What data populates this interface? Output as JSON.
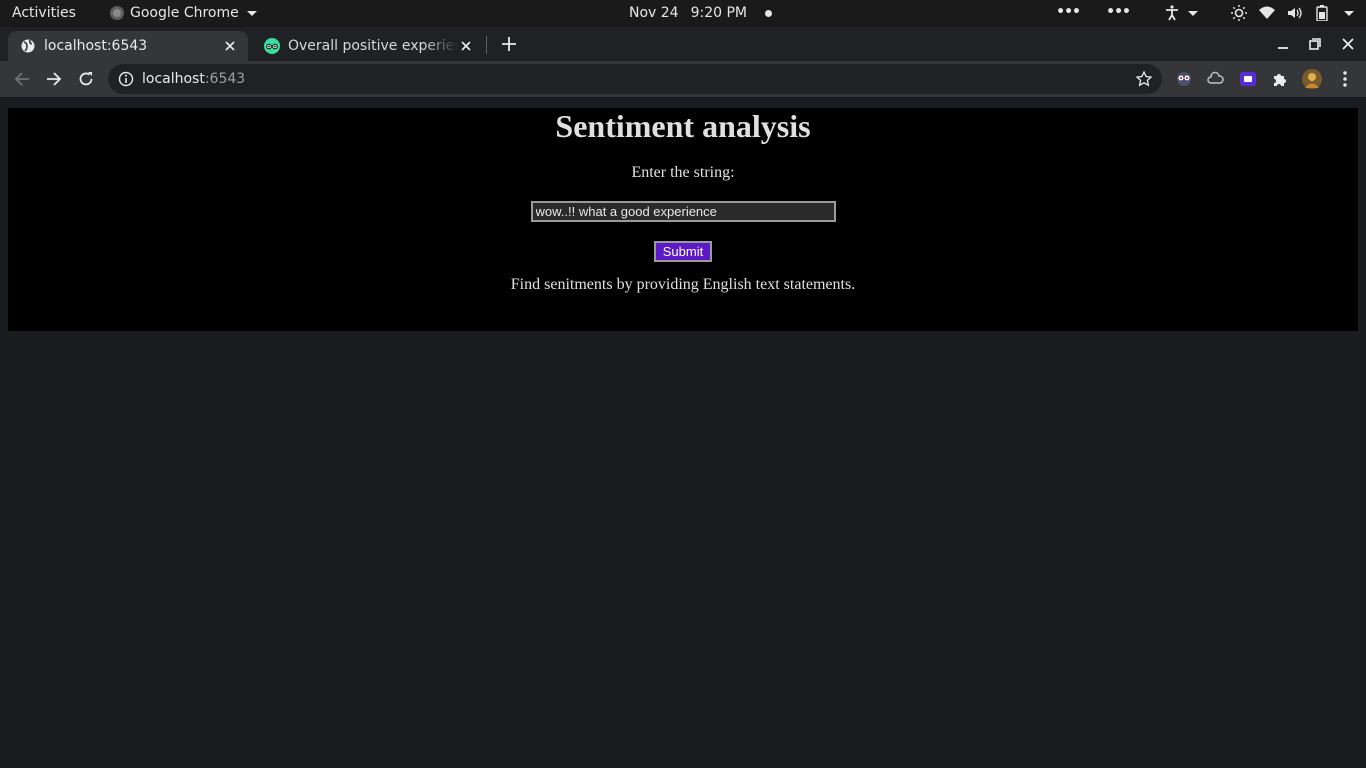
{
  "system_bar": {
    "activities": "Activities",
    "app_name": "Google Chrome",
    "date": "Nov 24",
    "time": "9:20 PM"
  },
  "tabs": [
    {
      "title": "localhost:6543",
      "active": true,
      "icon": "globe-icon"
    },
    {
      "title": "Overall positive experience",
      "active": false,
      "icon": "tripadvisor-icon"
    }
  ],
  "toolbar": {
    "url_host": "localhost",
    "url_port": ":6543"
  },
  "page": {
    "heading": "Sentiment analysis",
    "prompt": "Enter the string:",
    "input_value": "wow..!! what a good experience",
    "submit_label": "Submit",
    "footer": "Find senitments by providing English text statements."
  },
  "colors": {
    "submit_bg": "#5b19c8",
    "panel_bg": "#000000",
    "page_bg": "#1b1c1f"
  }
}
